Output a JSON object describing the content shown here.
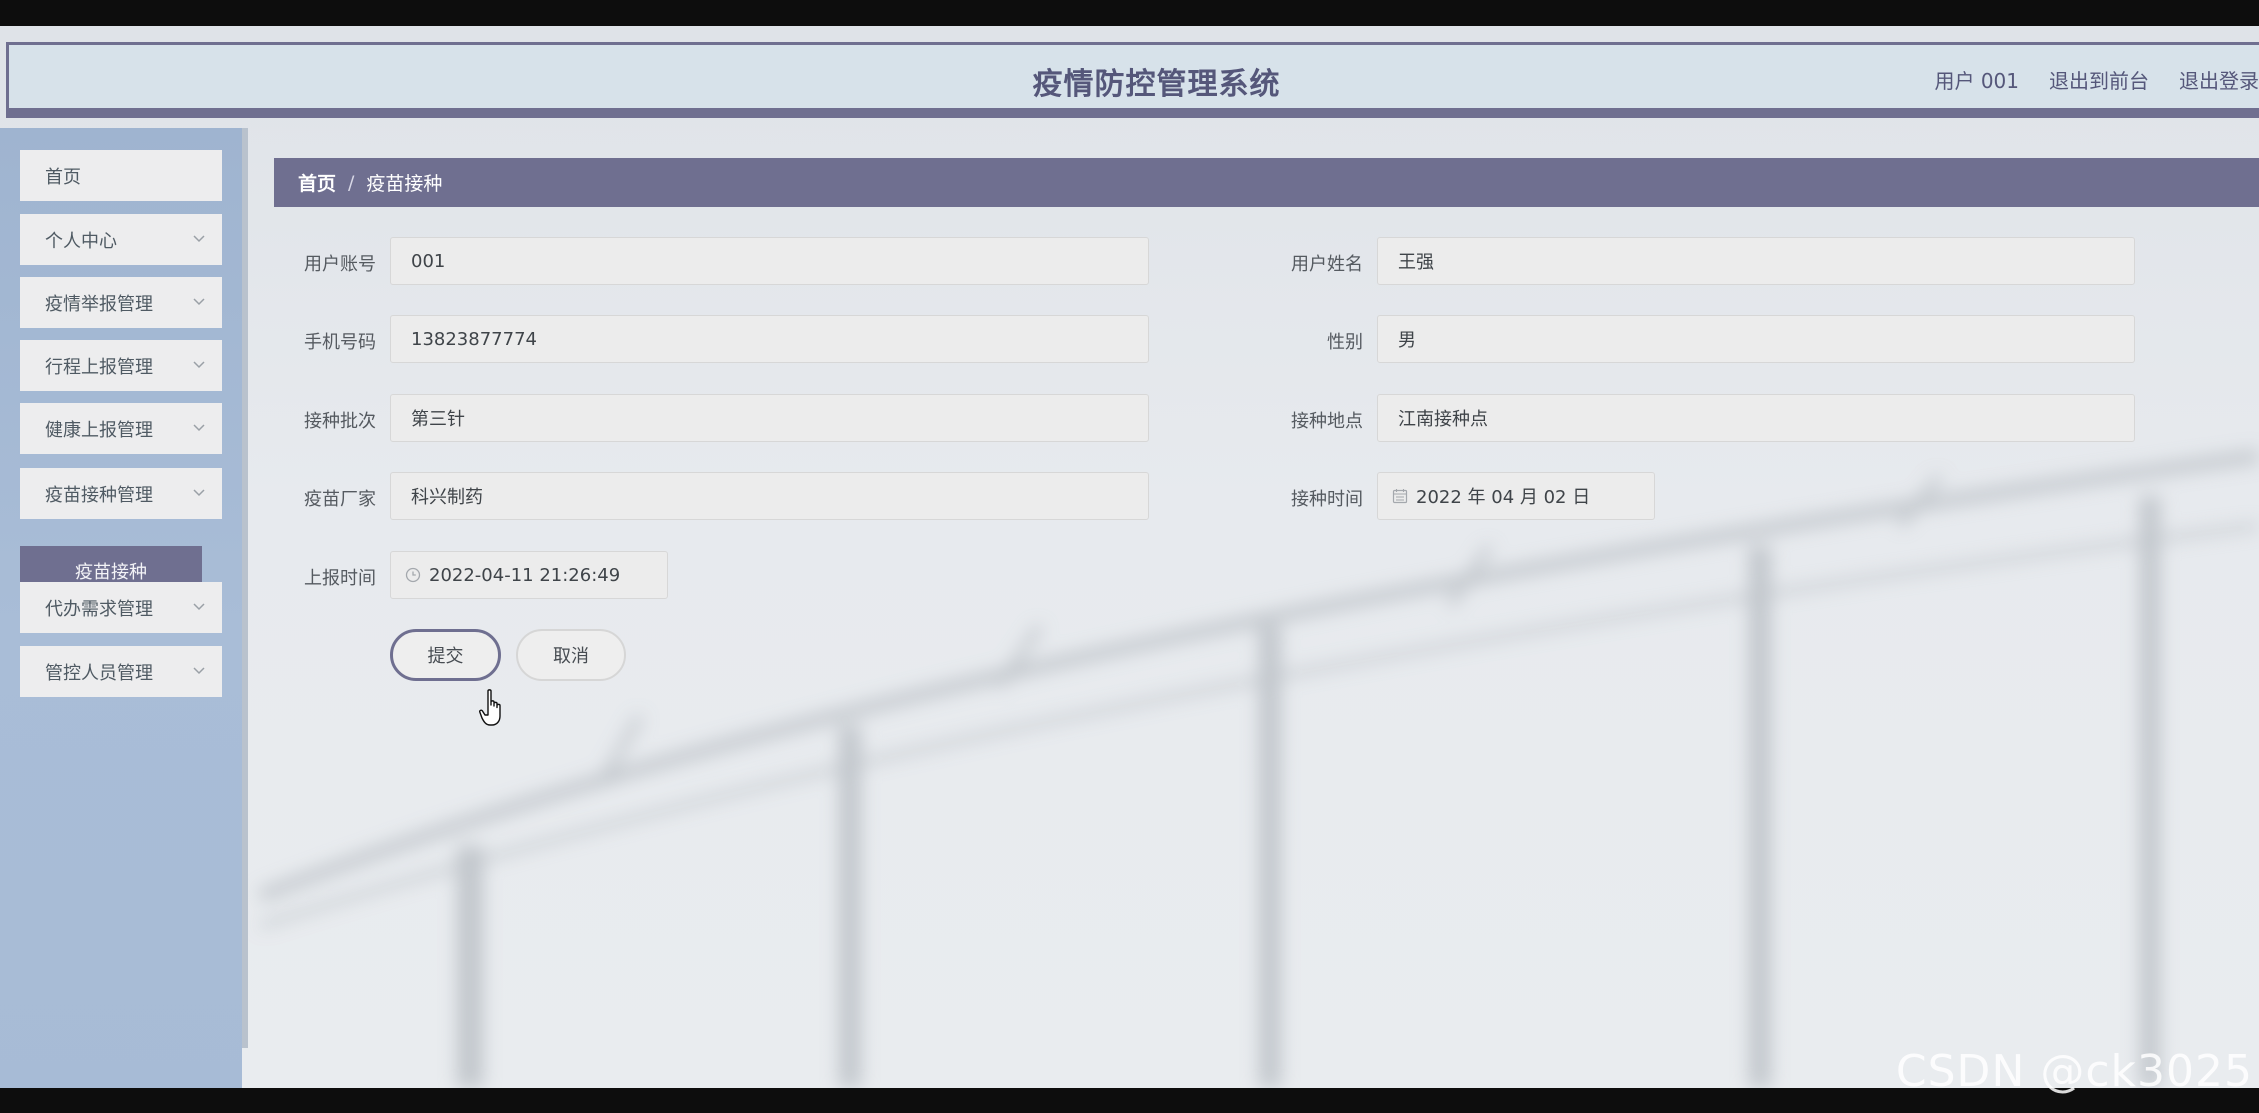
{
  "header": {
    "title": "疫情防控管理系统",
    "links": [
      "用户 001",
      "退出到前台",
      "退出登录"
    ]
  },
  "sidebar": {
    "items": [
      {
        "label": "首页",
        "has_submenu": false
      },
      {
        "label": "个人中心",
        "has_submenu": true
      },
      {
        "label": "疫情举报管理",
        "has_submenu": true
      },
      {
        "label": "行程上报管理",
        "has_submenu": true
      },
      {
        "label": "健康上报管理",
        "has_submenu": true
      },
      {
        "label": "疫苗接种管理",
        "has_submenu": true,
        "expanded": true
      },
      {
        "label": "代办需求管理",
        "has_submenu": true
      },
      {
        "label": "管控人员管理",
        "has_submenu": true
      }
    ],
    "active_subitem": "疫苗接种"
  },
  "breadcrumb": {
    "home": "首页",
    "separator": "/",
    "current": "疫苗接种"
  },
  "form": {
    "fields": [
      {
        "label": "用户账号",
        "value": "001"
      },
      {
        "label": "用户姓名",
        "value": "王强"
      },
      {
        "label": "手机号码",
        "value": "13823877774"
      },
      {
        "label": "性别",
        "value": "男"
      },
      {
        "label": "接种批次",
        "value": "第三针"
      },
      {
        "label": "接种地点",
        "value": "江南接种点"
      },
      {
        "label": "疫苗厂家",
        "value": "科兴制药"
      },
      {
        "label": "接种时间",
        "value": "2022 年 04 月 02 日",
        "icon": "calendar-icon"
      },
      {
        "label": "上报时间",
        "value": "2022-04-11 21:26:49",
        "icon": "clock-icon"
      }
    ],
    "submit_label": "提交",
    "cancel_label": "取消"
  },
  "watermark": "CSDN @ck3025",
  "colors": {
    "accent": "#6f6f90",
    "sidebar": "#a9bdd7",
    "header_bg": "#d7e2ea",
    "input_bg": "#ececec"
  }
}
